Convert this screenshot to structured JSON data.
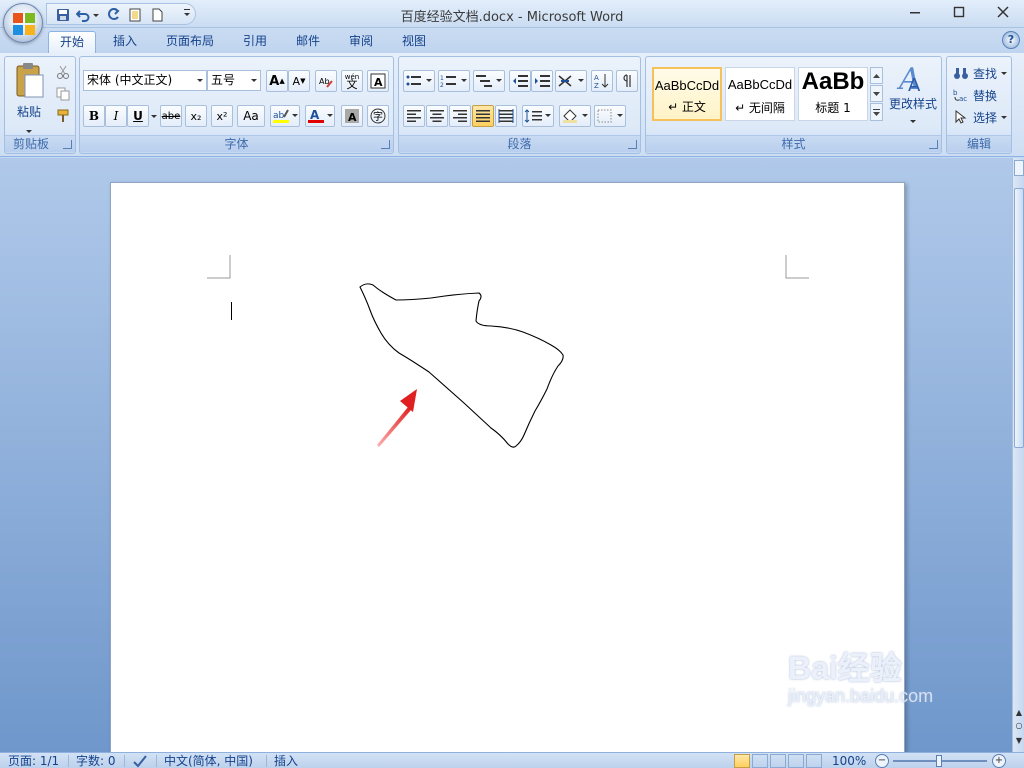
{
  "window": {
    "title": "百度经验文档.docx - Microsoft Word"
  },
  "tabs": [
    {
      "label": "开始",
      "active": true
    },
    {
      "label": "插入"
    },
    {
      "label": "页面布局"
    },
    {
      "label": "引用"
    },
    {
      "label": "邮件"
    },
    {
      "label": "审阅"
    },
    {
      "label": "视图"
    }
  ],
  "ribbon": {
    "clipboard": {
      "paste_label": "粘贴",
      "group_label": "剪贴板"
    },
    "font": {
      "font_name": "宋体 (中文正文)",
      "font_size": "五号",
      "bold": "B",
      "italic": "I",
      "underline": "U",
      "strike": "abe",
      "sub": "x₂",
      "sup": "x²",
      "case": "Aa",
      "grow": "A",
      "shrink": "A",
      "phonetic": "wén",
      "group_label": "字体"
    },
    "paragraph": {
      "group_label": "段落"
    },
    "styles": {
      "tiles": [
        {
          "sample": "AaBbCcDd",
          "name": "↵ 正文",
          "selected": true
        },
        {
          "sample": "AaBbCcDd",
          "name": "↵ 无间隔"
        },
        {
          "sample": "AaBb",
          "name": "标题 1"
        }
      ],
      "change_styles": "更改样式",
      "group_label": "样式"
    },
    "editing": {
      "find": "查找",
      "replace": "替换",
      "select": "选择",
      "group_label": "编辑"
    }
  },
  "status": {
    "page": "页面: 1/1",
    "words": "字数: 0",
    "language": "中文(简体, 中国)",
    "mode": "插入",
    "zoom": "100%"
  },
  "watermark": {
    "brand": "Bai经验",
    "url": "jingyan.baidu.com"
  },
  "colors": {
    "accent": "#15428b",
    "arrow": "#e02020",
    "highlight": "#ffff00",
    "font_color": "#e00000"
  }
}
